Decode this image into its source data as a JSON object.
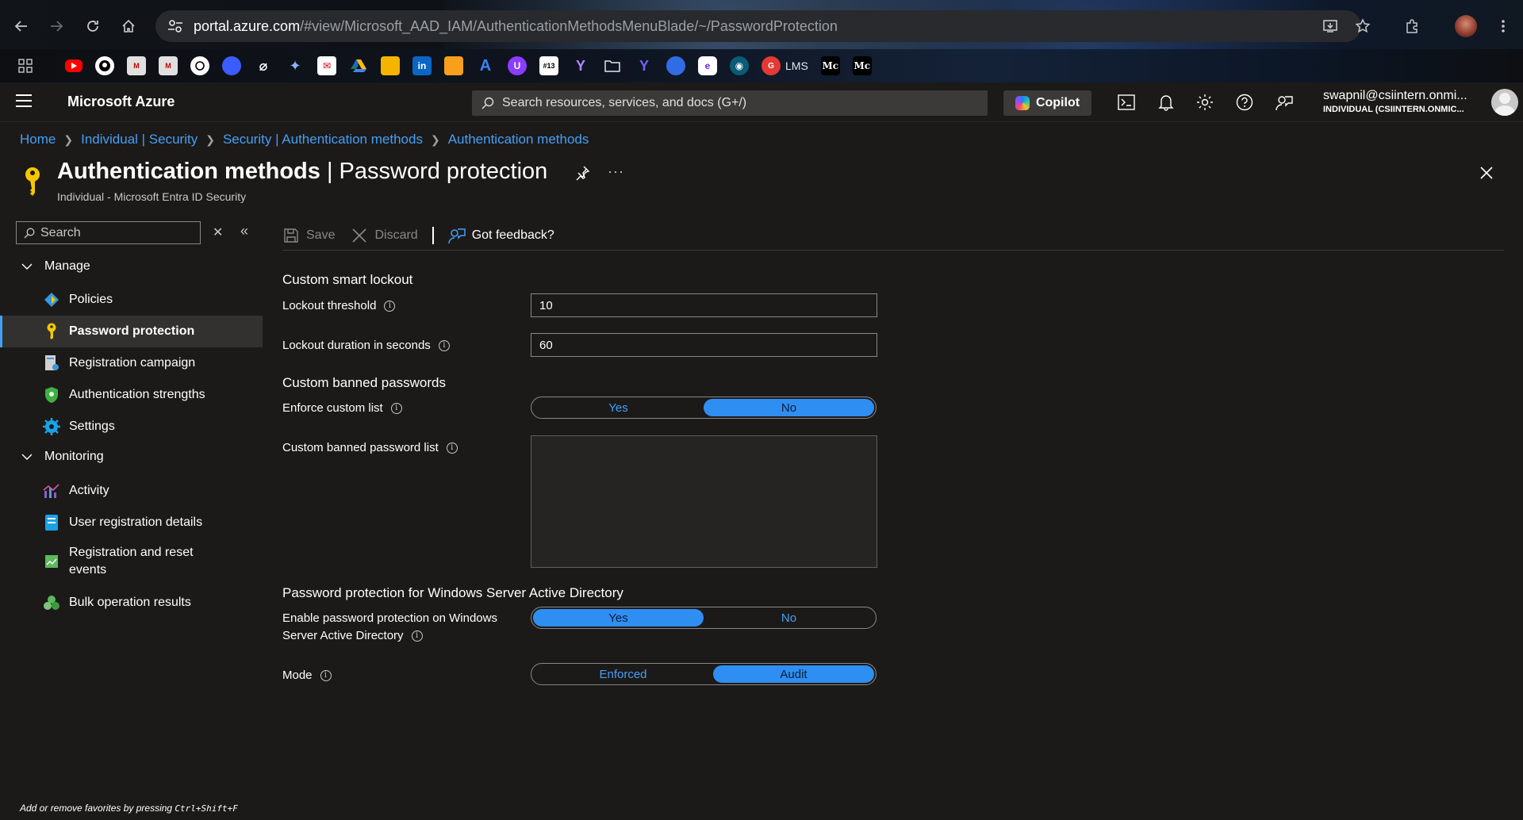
{
  "browser": {
    "url_host": "portal.azure.com",
    "url_path": "/#view/Microsoft_AAD_IAM/AuthenticationMethodsMenuBlade/~/PasswordProtection",
    "bookmark_texts": [
      "LMS",
      "Mc",
      "Mc",
      "#13"
    ]
  },
  "header": {
    "brand": "Microsoft Azure",
    "search_placeholder": "Search resources, services, and docs (G+/)",
    "copilot_label": "Copilot",
    "user_name": "swapnil@csiintern.onmi...",
    "user_tenant": "INDIVIDUAL (CSIINTERN.ONMIC..."
  },
  "breadcrumb": [
    "Home",
    "Individual | Security",
    "Security | Authentication methods",
    "Authentication methods"
  ],
  "page": {
    "title_main": "Authentication methods",
    "title_sep": " | ",
    "title_sub": "Password protection",
    "subtitle": "Individual - Microsoft Entra ID Security",
    "more": "···"
  },
  "nav": {
    "search_placeholder": "Search",
    "groups": {
      "manage": "Manage",
      "monitoring": "Monitoring"
    },
    "items": [
      {
        "label": "Policies"
      },
      {
        "label": "Password protection"
      },
      {
        "label": "Registration campaign"
      },
      {
        "label": "Authentication strengths"
      },
      {
        "label": "Settings"
      },
      {
        "label": "Activity"
      },
      {
        "label": "User registration details"
      },
      {
        "label": "Registration and reset events"
      },
      {
        "label": "Bulk operation results"
      }
    ],
    "footer_prefix": "Add or remove favorites by pressing ",
    "footer_shortcut": "Ctrl+Shift+F"
  },
  "toolbar": {
    "save": "Save",
    "discard": "Discard",
    "feedback": "Got feedback?"
  },
  "form": {
    "smart_lockout_title": "Custom smart lockout",
    "lockout_threshold_label": "Lockout threshold",
    "lockout_threshold_value": "10",
    "lockout_duration_label": "Lockout duration in seconds",
    "lockout_duration_value": "60",
    "banned_title": "Custom banned passwords",
    "enforce_label": "Enforce custom list",
    "enforce_yes": "Yes",
    "enforce_no": "No",
    "enforce_selected": "No",
    "banned_list_label": "Custom banned password list",
    "ad_title": "Password protection for Windows Server Active Directory",
    "ad_enable_label_1": "Enable password protection on Windows",
    "ad_enable_label_2": "Server Active Directory",
    "ad_yes": "Yes",
    "ad_no": "No",
    "ad_selected": "Yes",
    "mode_label": "Mode",
    "mode_enforced": "Enforced",
    "mode_audit": "Audit",
    "mode_selected": "Audit"
  },
  "colors": {
    "accent": "#479ef5",
    "toggle_on": "#2f8ef2",
    "background": "#1b1a19"
  }
}
